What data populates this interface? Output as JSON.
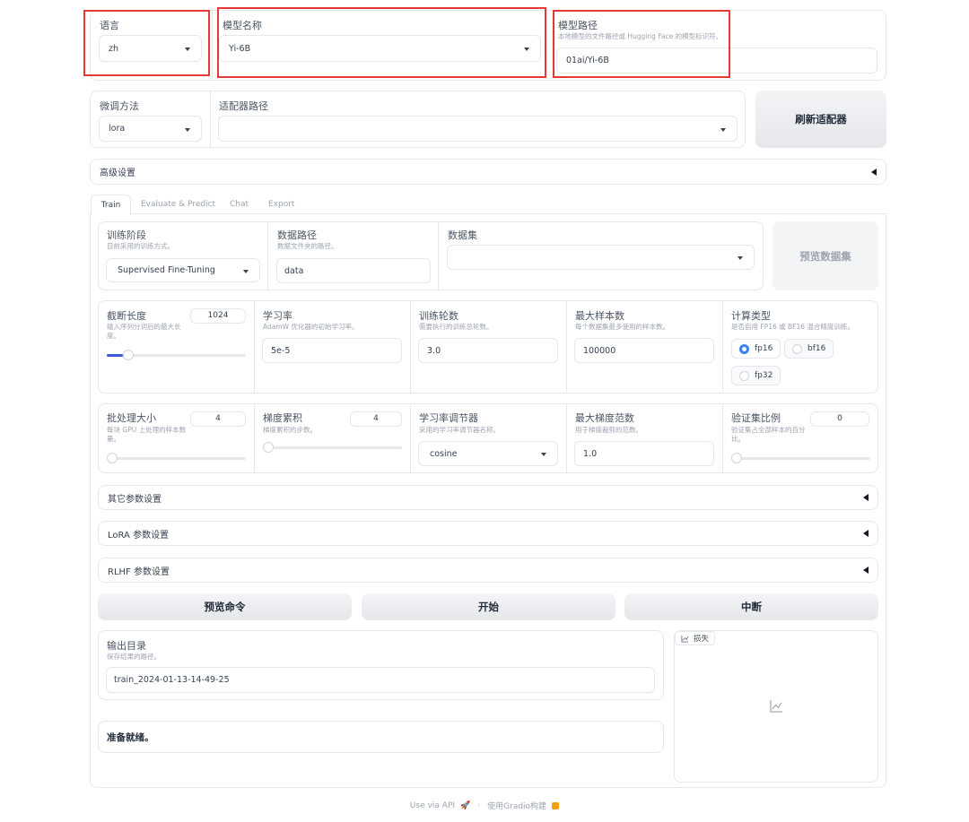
{
  "top": {
    "language": {
      "label": "语言",
      "value": "zh"
    },
    "model_name": {
      "label": "模型名称",
      "value": "Yi-6B"
    },
    "model_path": {
      "label": "模型路径",
      "info": "本地模型的文件路径或 Hugging Face 的模型标识符。",
      "value": "01ai/Yi-6B"
    }
  },
  "row2": {
    "finetune": {
      "label": "微调方法",
      "value": "lora"
    },
    "adapter": {
      "label": "适配器路径",
      "value": ""
    },
    "refresh_label": "刷新适配器"
  },
  "advanced_label": "高级设置",
  "tabs": [
    "Train",
    "Evaluate & Predict",
    "Chat",
    "Export"
  ],
  "train": {
    "stage": {
      "label": "训练阶段",
      "info": "目前采用的训练方式。",
      "value": "Supervised Fine-Tuning"
    },
    "data_path": {
      "label": "数据路径",
      "info": "数据文件夹的路径。",
      "value": "data"
    },
    "dataset": {
      "label": "数据集",
      "value": ""
    },
    "preview_dataset_label": "预览数据集",
    "cutoff": {
      "label": "截断长度",
      "info": "输入序列分词后的最大长度。",
      "value": "1024",
      "fraction": 0.0625
    },
    "lr": {
      "label": "学习率",
      "info": "AdamW 优化器的初始学习率。",
      "value": "5e-5"
    },
    "epochs": {
      "label": "训练轮数",
      "info": "需要执行的训练总轮数。",
      "value": "3.0"
    },
    "max_samples": {
      "label": "最大样本数",
      "info": "每个数据集最多使用的样本数。",
      "value": "100000"
    },
    "compute_type": {
      "label": "计算类型",
      "info": "是否启用 FP16 或 BF16 混合精度训练。",
      "options": [
        "fp16",
        "bf16",
        "fp32"
      ],
      "selected": "fp16"
    },
    "batch": {
      "label": "批处理大小",
      "info": "每块 GPU 上处理的样本数量。",
      "value": "4",
      "fraction": 0.0
    },
    "grad_accum": {
      "label": "梯度累积",
      "info": "梯度累积的步数。",
      "value": "4",
      "fraction": 0.0
    },
    "scheduler": {
      "label": "学习率调节器",
      "info": "采用的学习率调节器名称。",
      "value": "cosine"
    },
    "max_grad": {
      "label": "最大梯度范数",
      "info": "用于梯度裁剪的范数。",
      "value": "1.0"
    },
    "val_size": {
      "label": "验证集比例",
      "info": "验证集占全部样本的百分比。",
      "value": "0",
      "fraction": 0.0
    },
    "other_settings": "其它参数设置",
    "lora_settings": "LoRA 参数设置",
    "rlhf_settings": "RLHF 参数设置",
    "preview_cmd": "预览命令",
    "start": "开始",
    "abort": "中断",
    "output_dir": {
      "label": "输出目录",
      "info": "保存结果的路径。",
      "value": "train_2024-01-13-14-49-25"
    },
    "status": "准备就绪。",
    "loss_label": "损失"
  },
  "footer": {
    "api": "Use via API",
    "built": "使用Gradio构建"
  }
}
